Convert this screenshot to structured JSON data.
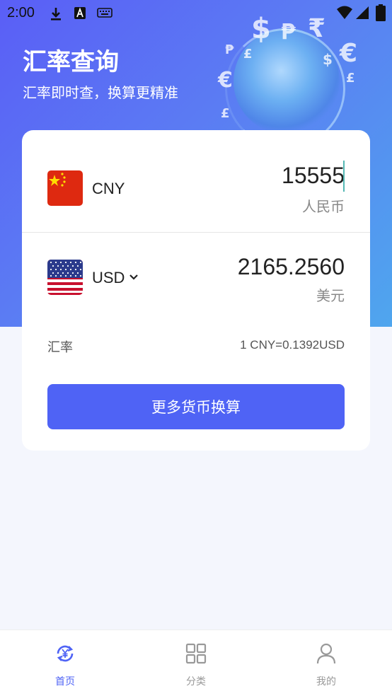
{
  "status_bar": {
    "time": "2:00"
  },
  "header": {
    "title": "汇率查询",
    "subtitle": "汇率即时查，换算更精准"
  },
  "converter": {
    "from": {
      "code": "CNY",
      "amount": "15555",
      "name": "人民币",
      "flag": "china-flag"
    },
    "to": {
      "code": "USD",
      "amount": "2165.2560",
      "name": "美元",
      "flag": "usa-flag"
    },
    "rate_label": "汇率",
    "rate_value": "1 CNY=0.1392USD",
    "more_button": "更多货币换算"
  },
  "tabbar": {
    "items": [
      {
        "label": "首页",
        "icon": "yuan-exchange-icon",
        "active": true
      },
      {
        "label": "分类",
        "icon": "grid-icon",
        "active": false
      },
      {
        "label": "我的",
        "icon": "user-icon",
        "active": false
      }
    ]
  },
  "colors": {
    "accent": "#4f63f5",
    "hero_start": "#5a5ef6",
    "hero_end": "#4fa6ee",
    "background": "#f4f6fd",
    "china_red": "#de2910",
    "china_star": "#ffde00"
  }
}
